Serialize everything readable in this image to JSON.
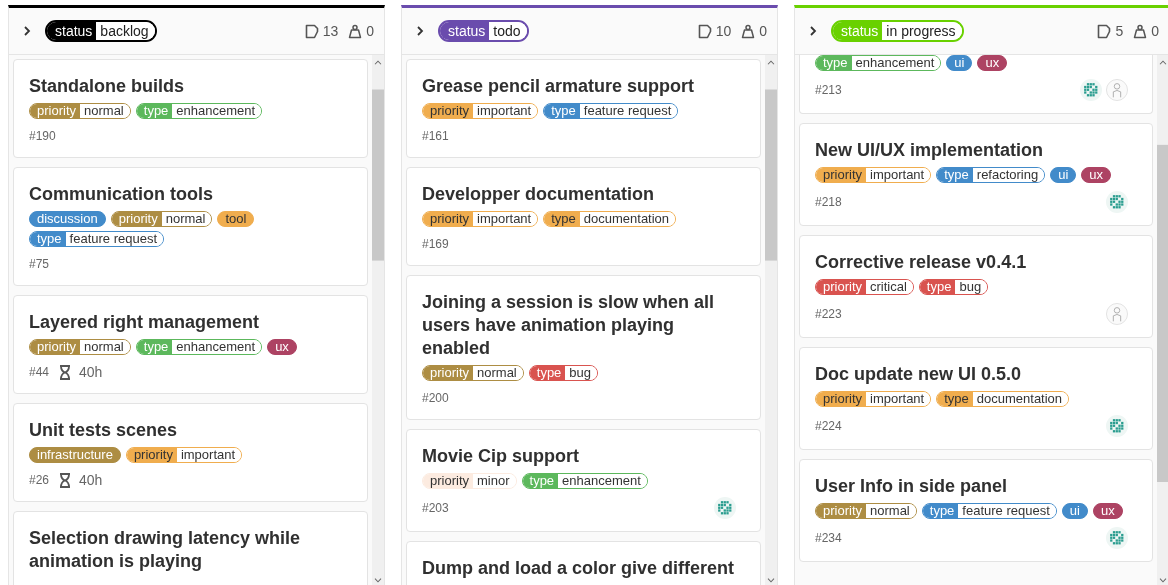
{
  "columns": [
    {
      "status": {
        "scope": "status",
        "value": "backlog",
        "color": "#000000"
      },
      "issue_count": "13",
      "weight": "0",
      "cards": [
        {
          "title": "Standalone builds",
          "labels": [
            {
              "kind": "scoped",
              "scope": "priority",
              "value": "normal",
              "color": "#ad8d43"
            },
            {
              "kind": "scoped",
              "scope": "type",
              "value": "enhancement",
              "color": "#5cb85c"
            }
          ],
          "number": "#190"
        },
        {
          "title": "Communication tools",
          "labels": [
            {
              "kind": "simple",
              "text": "discussion",
              "color": "#428bca"
            },
            {
              "kind": "scoped",
              "scope": "priority",
              "value": "normal",
              "color": "#ad8d43"
            },
            {
              "kind": "simple",
              "text": "tool",
              "color": "#f0ad4e"
            },
            {
              "kind": "scoped",
              "scope": "type",
              "value": "feature request",
              "color": "#428bca"
            }
          ],
          "number": "#75"
        },
        {
          "title": "Layered right management",
          "labels": [
            {
              "kind": "scoped",
              "scope": "priority",
              "value": "normal",
              "color": "#ad8d43"
            },
            {
              "kind": "scoped",
              "scope": "type",
              "value": "enhancement",
              "color": "#5cb85c"
            },
            {
              "kind": "simple",
              "text": "ux",
              "color": "#ad4363"
            }
          ],
          "number": "#44",
          "estimate": "40h"
        },
        {
          "title": "Unit tests scenes",
          "labels": [
            {
              "kind": "simple",
              "text": "infrastructure",
              "color": "#ad8d43"
            },
            {
              "kind": "scoped",
              "scope": "priority",
              "value": "important",
              "color": "#f0ad4e"
            }
          ],
          "number": "#26",
          "estimate": "40h"
        },
        {
          "title": "Selection drawing latency while animation is playing"
        }
      ]
    },
    {
      "status": {
        "scope": "status",
        "value": "todo",
        "color": "#6a4cad"
      },
      "issue_count": "10",
      "weight": "0",
      "cards": [
        {
          "title": "Grease pencil armature support",
          "labels": [
            {
              "kind": "scoped",
              "scope": "priority",
              "value": "important",
              "color": "#f0ad4e"
            },
            {
              "kind": "scoped",
              "scope": "type",
              "value": "feature request",
              "color": "#428bca"
            }
          ],
          "number": "#161"
        },
        {
          "title": "Developper documentation",
          "labels": [
            {
              "kind": "scoped",
              "scope": "priority",
              "value": "important",
              "color": "#f0ad4e"
            },
            {
              "kind": "scoped",
              "scope": "type",
              "value": "documentation",
              "color": "#f0ad4e"
            }
          ],
          "number": "#169"
        },
        {
          "title": "Joining a session is slow when all users have animation playing enabled",
          "labels": [
            {
              "kind": "scoped",
              "scope": "priority",
              "value": "normal",
              "color": "#ad8d43"
            },
            {
              "kind": "scoped",
              "scope": "type",
              "value": "bug",
              "color": "#d9534f"
            }
          ],
          "number": "#200"
        },
        {
          "title": "Movie Cip support",
          "labels": [
            {
              "kind": "scoped",
              "scope": "priority",
              "value": "minor",
              "color": "#fcebe0"
            },
            {
              "kind": "scoped",
              "scope": "type",
              "value": "enhancement",
              "color": "#5cb85c"
            }
          ],
          "number": "#203",
          "assignees": [
            {
              "kind": "identicon"
            }
          ]
        },
        {
          "title": "Dump and load a color give different"
        }
      ]
    },
    {
      "status": {
        "scope": "status",
        "value": "in progress",
        "color": "#69d100"
      },
      "issue_count": "5",
      "weight": "0",
      "cards": [
        {
          "labels": [
            {
              "kind": "scoped",
              "scope": "type",
              "value": "enhancement",
              "color": "#5cb85c"
            },
            {
              "kind": "simple",
              "text": "ui",
              "color": "#428bca"
            },
            {
              "kind": "simple",
              "text": "ux",
              "color": "#ad4363"
            }
          ],
          "number": "#213",
          "assignees": [
            {
              "kind": "identicon"
            },
            {
              "kind": "default"
            }
          ]
        },
        {
          "title": "New UI/UX implementation",
          "labels": [
            {
              "kind": "scoped",
              "scope": "priority",
              "value": "important",
              "color": "#f0ad4e"
            },
            {
              "kind": "scoped",
              "scope": "type",
              "value": "refactoring",
              "color": "#428bca"
            },
            {
              "kind": "simple",
              "text": "ui",
              "color": "#428bca"
            },
            {
              "kind": "simple",
              "text": "ux",
              "color": "#ad4363"
            }
          ],
          "number": "#218",
          "assignees": [
            {
              "kind": "identicon"
            }
          ]
        },
        {
          "title": "Corrective release v0.4.1",
          "labels": [
            {
              "kind": "scoped",
              "scope": "priority",
              "value": "critical",
              "color": "#d9534f"
            },
            {
              "kind": "scoped",
              "scope": "type",
              "value": "bug",
              "color": "#d9534f"
            }
          ],
          "number": "#223",
          "assignees": [
            {
              "kind": "default"
            }
          ]
        },
        {
          "title": "Doc update new UI 0.5.0",
          "labels": [
            {
              "kind": "scoped",
              "scope": "priority",
              "value": "important",
              "color": "#f0ad4e"
            },
            {
              "kind": "scoped",
              "scope": "type",
              "value": "documentation",
              "color": "#f0ad4e"
            }
          ],
          "number": "#224",
          "assignees": [
            {
              "kind": "identicon"
            }
          ]
        },
        {
          "title": "User Info in side panel",
          "labels": [
            {
              "kind": "scoped",
              "scope": "priority",
              "value": "normal",
              "color": "#ad8d43"
            },
            {
              "kind": "scoped",
              "scope": "type",
              "value": "feature request",
              "color": "#428bca"
            },
            {
              "kind": "simple",
              "text": "ui",
              "color": "#428bca"
            },
            {
              "kind": "simple",
              "text": "ux",
              "color": "#ad4363"
            }
          ],
          "number": "#234",
          "assignees": [
            {
              "kind": "identicon"
            }
          ]
        }
      ]
    }
  ]
}
